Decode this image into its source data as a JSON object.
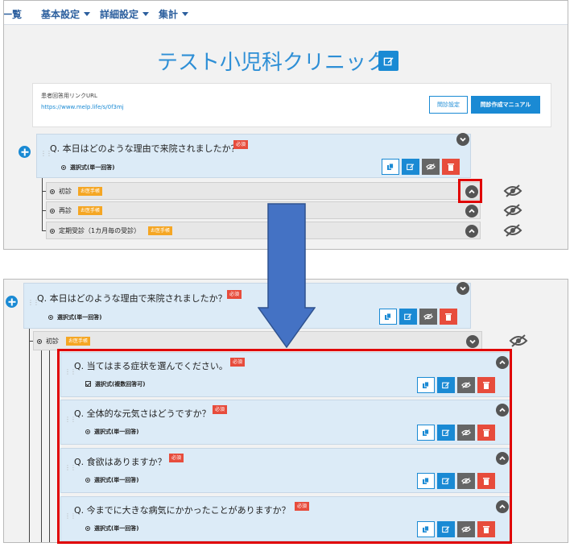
{
  "nav": {
    "items": [
      {
        "label": "一覧",
        "has_caret": false
      },
      {
        "label": "基本設定",
        "has_caret": true
      },
      {
        "label": "詳細設定",
        "has_caret": true
      },
      {
        "label": "集計",
        "has_caret": true
      }
    ]
  },
  "clinic": {
    "title": "テスト小児科クリニック"
  },
  "url_box": {
    "label": "患者回答用リンクURL",
    "link": "https://www.melp.life/s/0f3mj",
    "btn_settings": "問診設定",
    "btn_manual": "問診作成マニュアル"
  },
  "required_label": "必須",
  "doctor_tag": "お医手帳",
  "main_question": {
    "text": "Q. 本日はどのような理由で来院されましたか？",
    "type": "選択式(単一回答)"
  },
  "choices": [
    {
      "label": "初診"
    },
    {
      "label": "再診"
    },
    {
      "label": "定期受診（1カ月毎の受診）"
    }
  ],
  "sub_questions": [
    {
      "text": "Q. 当てはまる症状を選んでください。",
      "type": "選択式(複数回答可)",
      "multi": true
    },
    {
      "text": "Q. 全体的な元気さはどうですか？",
      "type": "選択式(単一回答)",
      "multi": false
    },
    {
      "text": "Q. 食欲はありますか？",
      "type": "選択式(単一回答)",
      "multi": false
    },
    {
      "text": "Q. 今までに大きな病気にかかったことがありますか？",
      "type": "選択式(単一回答)",
      "multi": false
    }
  ],
  "colors": {
    "accent": "#1a8ad4",
    "required": "#e74c3c",
    "tag": "#f5a623",
    "card_bg": "#dcebf7",
    "highlight": "#e00000",
    "arrow": "#4472c4"
  },
  "icons": [
    "edit-icon",
    "copy-icon",
    "eye-slash-icon",
    "trash-icon",
    "chevron-down-icon",
    "chevron-up-icon",
    "plus-icon",
    "radio-icon",
    "checkbox-icon",
    "grip-icon"
  ]
}
